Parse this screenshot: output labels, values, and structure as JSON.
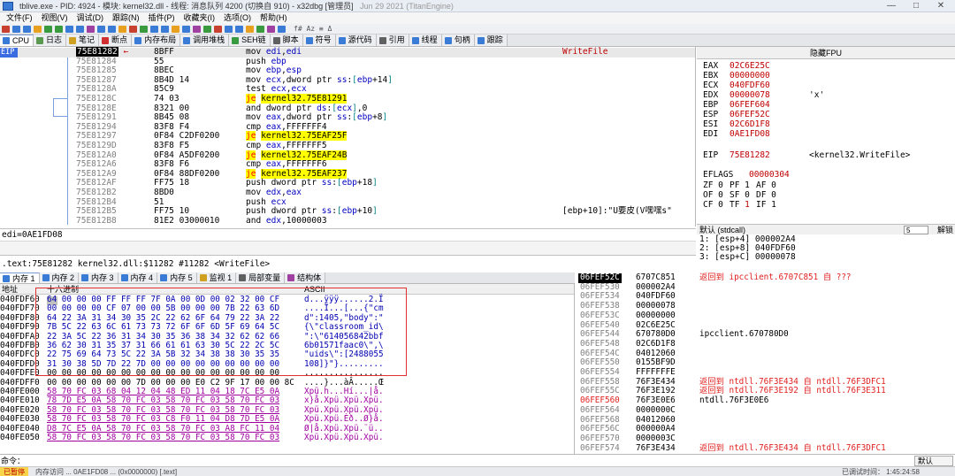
{
  "window": {
    "title": "tblive.exe - PID: 4924 - 模块: kernel32.dll - 线程: 消息队列 4200 (切换自 910) - x32dbg [管理员]",
    "date": "Jun 29 2021 (TitanEngine)",
    "controls": [
      "—",
      "□",
      "✕"
    ]
  },
  "menu": [
    "文件(F)",
    "视图(V)",
    "调试(D)",
    "跟踪(N)",
    "插件(P)",
    "收藏夹(I)",
    "选项(O)",
    "帮助(H)"
  ],
  "toolbar": {
    "icon_colors": [
      "#c84030",
      "#3a7bd5",
      "#3a7bd5",
      "#e8a020",
      "#3a9a40",
      "#3a9a40",
      "#3a7bd5",
      "#3a7bd5",
      "#a040a0",
      "#3a7bd5",
      "#3a7bd5",
      "#e8a020",
      "#c84030",
      "#3a9a40",
      "#3a7bd5",
      "#3a7bd5",
      "#e8a020",
      "#3a7bd5",
      "#a040a0",
      "#3a9a40",
      "#c84030",
      "#3a7bd5",
      "#3a7bd5",
      "#e8a020",
      "#3a9a40",
      "#a040a0",
      "#3a7bd5"
    ],
    "tail": "f# Az ≡ Δ"
  },
  "tabs": [
    {
      "label": "CPU",
      "color": "#3a7bd5",
      "active": true
    },
    {
      "label": "日志",
      "color": "#5a9a50"
    },
    {
      "label": "笔记",
      "color": "#d0a020"
    },
    {
      "label": "断点",
      "color": "#d03030"
    },
    {
      "label": "内存布局",
      "color": "#3a7bd5"
    },
    {
      "label": "调用堆栈",
      "color": "#3a7bd5"
    },
    {
      "label": "SEH链",
      "color": "#3a9a40"
    },
    {
      "label": "脚本",
      "color": "#606060"
    },
    {
      "label": "符号",
      "color": "#3a7bd5"
    },
    {
      "label": "源代码",
      "color": "#3a7bd5"
    },
    {
      "label": "引用",
      "color": "#606060"
    },
    {
      "label": "线程",
      "color": "#3a7bd5"
    },
    {
      "label": "句柄",
      "color": "#3a7bd5"
    },
    {
      "label": "跟踪",
      "color": "#3a7bd5"
    }
  ],
  "disasm": {
    "eip_label": "EIP",
    "rows": [
      {
        "addr": "75E81282",
        "bytes": "8BFF",
        "ins": "mov edi,edi",
        "com": "WriteFile",
        "eip": true
      },
      {
        "addr": "75E81284",
        "bytes": "55",
        "ins": "push ebp"
      },
      {
        "addr": "75E81285",
        "bytes": "8BEC",
        "ins": "mov ebp,esp"
      },
      {
        "addr": "75E81287",
        "bytes": "8B4D 14",
        "ins": "mov ecx,dword ptr ss:[ebp+14]"
      },
      {
        "addr": "75E8128A",
        "bytes": "85C9",
        "ins": "test ecx,ecx"
      },
      {
        "addr": "75E8128C",
        "bytes": "74 03",
        "ins": "je kernel32.75E81291",
        "jcc": true
      },
      {
        "addr": "75E8128E",
        "bytes": "8321 00",
        "ins": "and dword ptr ds:[ecx],0"
      },
      {
        "addr": "75E81291",
        "bytes": "8B45 08",
        "ins": "mov eax,dword ptr ss:[ebp+8]"
      },
      {
        "addr": "75E81294",
        "bytes": "83F8 F4",
        "ins": "cmp eax,FFFFFFF4"
      },
      {
        "addr": "75E81297",
        "bytes": "0F84 C2DF0200",
        "ins": "je kernel32.75EAF25F",
        "jcc": true
      },
      {
        "addr": "75E8129D",
        "bytes": "83F8 F5",
        "ins": "cmp eax,FFFFFFF5"
      },
      {
        "addr": "75E812A0",
        "bytes": "0F84 A5DF0200",
        "ins": "je kernel32.75EAF24B",
        "jcc": true
      },
      {
        "addr": "75E812A6",
        "bytes": "83F8 F6",
        "ins": "cmp eax,FFFFFFF6"
      },
      {
        "addr": "75E812A9",
        "bytes": "0F84 88DF0200",
        "ins": "je kernel32.75EAF237",
        "jcc": true
      },
      {
        "addr": "75E812AF",
        "bytes": "FF75 18",
        "ins": "push dword ptr ss:[ebp+18]"
      },
      {
        "addr": "75E812B2",
        "bytes": "8BD0",
        "ins": "mov edx,eax"
      },
      {
        "addr": "75E812B4",
        "bytes": "51",
        "ins": "push ecx"
      },
      {
        "addr": "75E812B5",
        "bytes": "FF75 10",
        "ins": "push dword ptr ss:[ebp+10]",
        "com": "[ebp+10]:\"U要皮(V嘿嘿s\""
      },
      {
        "addr": "75E812B8",
        "bytes": "81E2 03000010",
        "ins": "and edx,10000003"
      }
    ]
  },
  "registers": {
    "header": "隐藏FPU",
    "gp": [
      {
        "name": "EAX",
        "value": "02C6E25C"
      },
      {
        "name": "EBX",
        "value": "00000000"
      },
      {
        "name": "ECX",
        "value": "040FDF60"
      },
      {
        "name": "EDX",
        "value": "00000078",
        "comment": "'x'"
      },
      {
        "name": "EBP",
        "value": "06FEF604"
      },
      {
        "name": "ESP",
        "value": "06FEF52C"
      },
      {
        "name": "ESI",
        "value": "02C6D1F8"
      },
      {
        "name": "EDI",
        "value": "0AE1FD08"
      }
    ],
    "eip": {
      "name": "EIP",
      "value": "75E81282",
      "comment": "<kernel32.WriteFile>"
    },
    "eflags": {
      "name": "EFLAGS",
      "value": "00000304"
    },
    "flags": [
      [
        "ZF",
        "0"
      ],
      [
        "PF",
        "1"
      ],
      [
        "AF",
        "0"
      ],
      [
        "OF",
        "0"
      ],
      [
        "SF",
        "0"
      ],
      [
        "DF",
        "0"
      ],
      [
        "CF",
        "0"
      ],
      [
        "TF",
        "1"
      ],
      [
        "IF",
        "1"
      ]
    ]
  },
  "callconv": {
    "label": "默认 (stdcall)",
    "count": "5",
    "unlock": "解锁"
  },
  "args": [
    "1: [esp+4] 000002A4",
    "2: [esp+8] 040FDF60",
    "3: [esp+C] 00000078"
  ],
  "info": {
    "line1": "edi=0AE1FD08",
    "line3": ".text:75E81282 kernel32.dll:$11282 #11282 <WriteFile>"
  },
  "dump_tabs": [
    {
      "label": "内存 1",
      "active": true
    },
    {
      "label": "内存 2"
    },
    {
      "label": "内存 3"
    },
    {
      "label": "内存 4"
    },
    {
      "label": "内存 5"
    },
    {
      "label": "监视 1"
    },
    {
      "label": "局部变量"
    },
    {
      "label": "结构体"
    }
  ],
  "dump": {
    "col_addr": "地址",
    "col_hex": "十六进制",
    "col_ascii": "ASCII",
    "rows": [
      {
        "addr": "040FDF60",
        "hex": "64 00 00 00 FF FF FF 7F 0A 00 0D 00 02 32 00 CF",
        "ascii": "d...ÿÿÿ......2.Ï"
      },
      {
        "addr": "040FDF70",
        "hex": "00 00 00 00 CF 07 00 00 5B 00 00 00 7B 22 63 6D",
        "ascii": "....Ï...[...{\"cm"
      },
      {
        "addr": "040FDF80",
        "hex": "64 22 3A 31 34 30 35 2C 22 62 6F 64 79 22 3A 22",
        "ascii": "d\":1405,\"body\":\""
      },
      {
        "addr": "040FDF90",
        "hex": "7B 5C 22 63 6C 61 73 73 72 6F 6F 6D 5F 69 64 5C",
        "ascii": "{\\\"classroom_id\\"
      },
      {
        "addr": "040FDFA0",
        "hex": "22 3A 5C 22 36 31 34 30 35 36 38 34 32 62 62 66",
        "ascii": "\":\\\"614056842bbf"
      },
      {
        "addr": "040FDFB0",
        "hex": "36 62 30 31 35 37 31 66 61 61 63 30 5C 22 2C 5C",
        "ascii": "6b01571faac0\\\",\\"
      },
      {
        "addr": "040FDFC0",
        "hex": "22 75 69 64 73 5C 22 3A 5B 32 34 38 38 30 35 35",
        "ascii": "\"uids\\\":[2488055"
      },
      {
        "addr": "040FDFD0",
        "hex": "31 30 38 5D 7D 22 7D 00 00 00 00 00 00 00 00 00",
        "ascii": "108]}\"}........."
      },
      {
        "addr": "040FDFE0",
        "hex": "00 00 00 00 00 00 00 00 00 00 00 00 00 00 00 00",
        "ascii": "................"
      },
      {
        "addr": "040FDFF0",
        "hex": "00 00 00 00 00 00 7D 00 00 00 E0 C2 9F 17 00 00 8C",
        "ascii": "....}...àÂ.....Œ"
      },
      {
        "addr": "040FE000",
        "hex": "58 70 FC 03 68 04 12 04 48 ED 11 04 18 7C E5 0A",
        "ascii": "Xpü.h...Hí...|å."
      },
      {
        "addr": "040FE010",
        "hex": "78 7D E5 0A 58 70 FC 03 58 70 FC 03 58 70 FC 03",
        "ascii": "x}å.Xpü.Xpü.Xpü."
      },
      {
        "addr": "040FE020",
        "hex": "58 70 FC 03 58 70 FC 03 58 70 FC 03 58 70 FC 03",
        "ascii": "Xpü.Xpü.Xpü.Xpü."
      },
      {
        "addr": "040FE030",
        "hex": "58 70 FC 03 58 70 FC 03 C8 F0 11 04 D8 7D E5 0A",
        "ascii": "Xpü.Xpü.Èð..Ø}å."
      },
      {
        "addr": "040FE040",
        "hex": "D8 7C E5 0A 58 70 FC 03 58 70 FC 03 A8 FC 11 04",
        "ascii": "Ø|å.Xpü.Xpü.¨ü.."
      },
      {
        "addr": "040FE050",
        "hex": "58 70 FC 03 58 70 FC 03 58 70 FC 03 58 70 FC 03",
        "ascii": "Xpü.Xpü.Xpü.Xpü."
      }
    ]
  },
  "stack": {
    "rows": [
      {
        "addr": "06FEF52C",
        "val": "6707C851",
        "com": "返回到 ipcclient.6707C851 自 ???",
        "ret": true,
        "top": true
      },
      {
        "addr": "06FEF530",
        "val": "000002A4"
      },
      {
        "addr": "06FEF534",
        "val": "040FDF60"
      },
      {
        "addr": "06FEF538",
        "val": "00000078"
      },
      {
        "addr": "06FEF53C",
        "val": "00000000"
      },
      {
        "addr": "06FEF540",
        "val": "02C6E25C"
      },
      {
        "addr": "06FEF544",
        "val": "670780D0",
        "com": "ipcclient.670780D0"
      },
      {
        "addr": "06FEF548",
        "val": "02C6D1F8"
      },
      {
        "addr": "06FEF54C",
        "val": "04012060"
      },
      {
        "addr": "06FEF550",
        "val": "0155BF9D"
      },
      {
        "addr": "06FEF554",
        "val": "FFFFFFFE"
      },
      {
        "addr": "06FEF558",
        "val": "76F3E434",
        "com": "返回到 ntdll.76F3E434 自 ntdll.76F3DFC1",
        "ret": true
      },
      {
        "addr": "06FEF55C",
        "val": "76F3E192",
        "com": "返回到 ntdll.76F3E192 自 ntdll.76F3E311",
        "ret": true
      },
      {
        "addr": "06FEF560",
        "val": "76F3E0E6",
        "com": "ntdll.76F3E0E6",
        "sel": true
      },
      {
        "addr": "06FEF564",
        "val": "0000000C"
      },
      {
        "addr": "06FEF568",
        "val": "04012060"
      },
      {
        "addr": "06FEF56C",
        "val": "000000A4"
      },
      {
        "addr": "06FEF570",
        "val": "0000003C"
      },
      {
        "addr": "06FEF574",
        "val": "76F3E434",
        "com": "返回到 ntdll.76F3E434 自 ntdll.76F3DFC1",
        "ret": true
      }
    ]
  },
  "cmdbar": {
    "label": "命令：",
    "default": "默认"
  },
  "status": {
    "paused": "已暂停",
    "message": "内存访问 ... 0AE1FD08 ... (0x0000000) [.text]",
    "right": "已调试时间： 1:45:24:58"
  }
}
